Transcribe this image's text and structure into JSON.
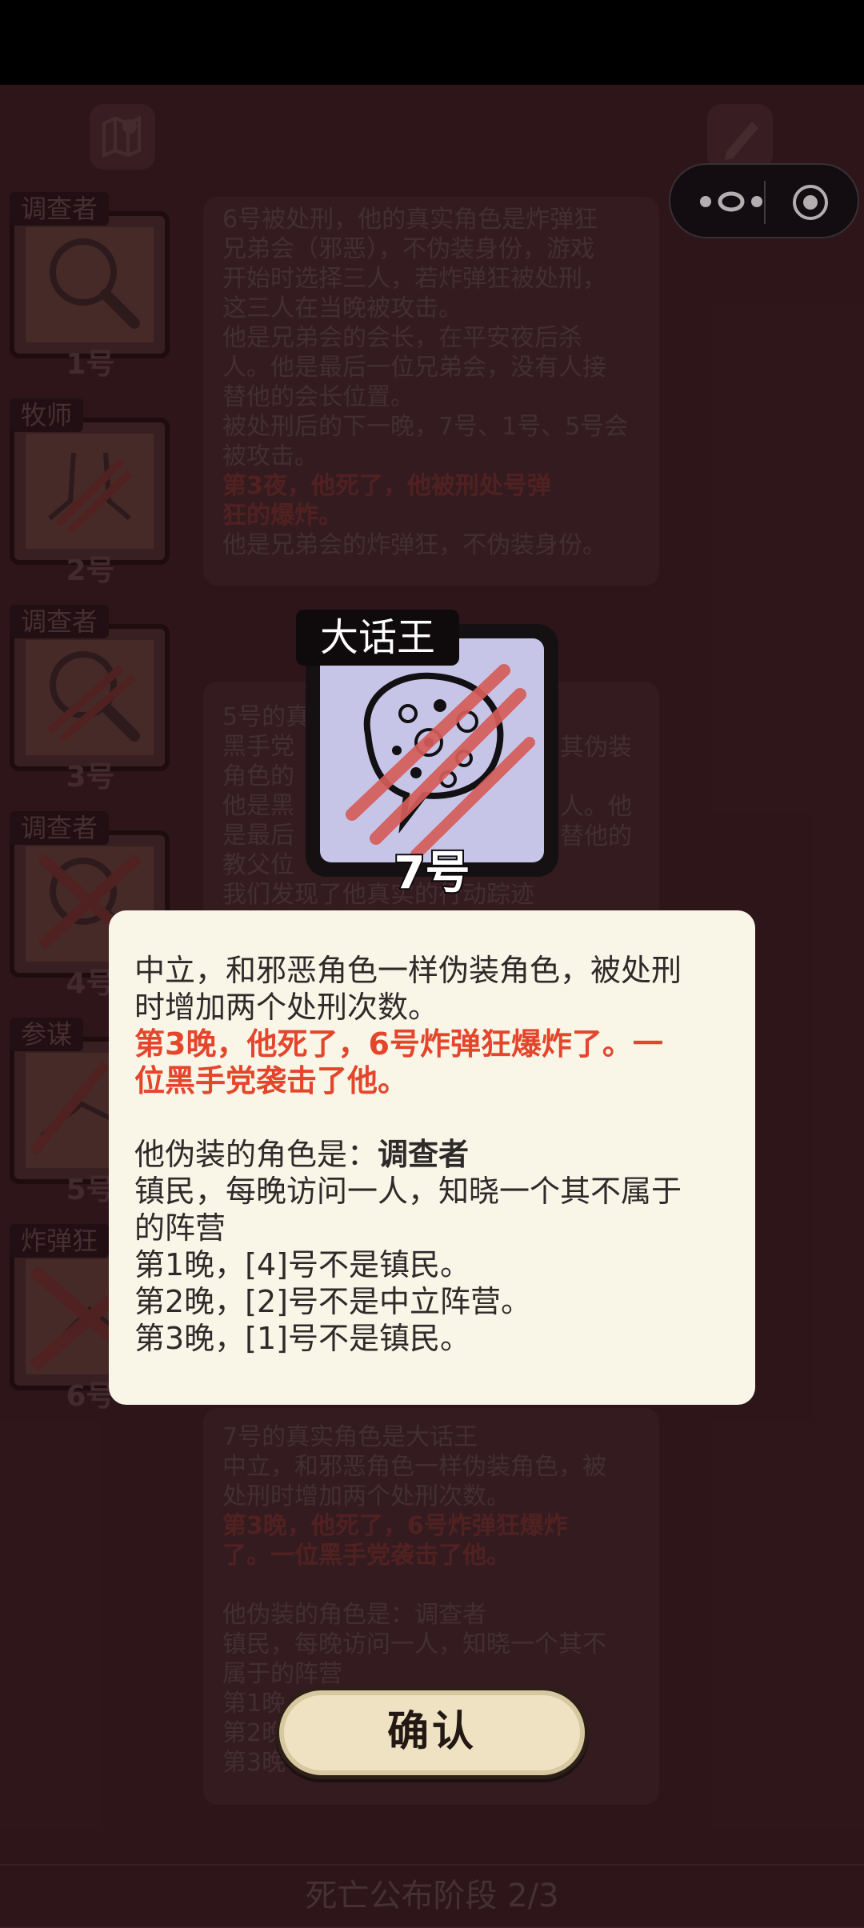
{
  "background_panels": {
    "panel1_lines": [
      "6号被处刑，他的真实角色是炸弹狂",
      "兄弟会（邪恶），不伪装身份，游戏",
      "开始时选择三人，若炸弹狂被处刑，",
      "这三人在当晚被攻击。",
      "他是兄弟会的会长，在平安夜后杀",
      "人。他是最后一位兄弟会，没有人接",
      "替他的会长位置。",
      "被处刑后的下一晚，7号、1号、5号会",
      "被攻击。"
    ],
    "panel1_red_lines": [
      "第3夜，他死了，他被刑处号弹",
      "狂的爆炸。"
    ],
    "panel1_last": "他是兄弟会的炸弹狂，不伪装身份。",
    "panel2_lines": [
      "5号的真",
      "黑手党",
      "角色的",
      "他是黑",
      "是最后",
      "教父位",
      "我们发现了他真实的行动踪迹"
    ],
    "panel2_right": [
      "其伪装",
      "人。他",
      "替他的"
    ],
    "panel3_lines": [
      "7号的真实角色是大话王",
      "中立，和邪恶角色一样伪装角色，被",
      "处刑时增加两个处刑次数。"
    ],
    "panel3_red_lines": [
      "第3晚，他死了，6号炸弹狂爆炸",
      "了。一位黑手党袭击了他。"
    ],
    "panel3_more": [
      "他伪装的角色是：调查者",
      "镇民，每晚访问一人，知晓一个其不",
      "属于的阵营",
      "第1晚",
      "第2晚",
      "第3晚"
    ]
  },
  "players": [
    {
      "role": "调查者",
      "num": "1号",
      "icon": "magnifier-icon"
    },
    {
      "role": "牧师",
      "num": "2号",
      "icon": "praying-hands-icon"
    },
    {
      "role": "调查者",
      "num": "3号",
      "icon": "magnifier-icon"
    },
    {
      "role": "调查者",
      "num": "4号",
      "icon": "magnifier-icon"
    },
    {
      "role": "参谋",
      "num": "5号",
      "icon": "hand-icon"
    },
    {
      "role": "炸弹狂",
      "num": "6号",
      "icon": "hand-icon"
    }
  ],
  "focus": {
    "role": "大话王",
    "num": "7号",
    "icon": "speech-bubble-icon"
  },
  "dialog": {
    "line1": "中立，和邪恶角色一样伪装角色，被处刑",
    "line2": "时增加两个处刑次数。",
    "red1": "第3晚，他死了，6号炸弹狂爆炸了。一",
    "red2": "位黑手党袭击了他。",
    "disguise_prefix": "他伪装的角色是：",
    "disguise_role": "调查者",
    "desc1": "镇民，每晚访问一人，知晓一个其不属于",
    "desc2": "的阵营",
    "night1": "第1晚，[4]号不是镇民。",
    "night2": "第2晚，[2]号不是中立阵营。",
    "night3": "第3晚，[1]号不是镇民。"
  },
  "confirm_label": "确认",
  "phase_label": "死亡公布阶段 2/3",
  "colors": {
    "accent_red": "#e4462c",
    "dialog_bg": "#f9f6e8",
    "button_bg": "#eee2c2"
  }
}
